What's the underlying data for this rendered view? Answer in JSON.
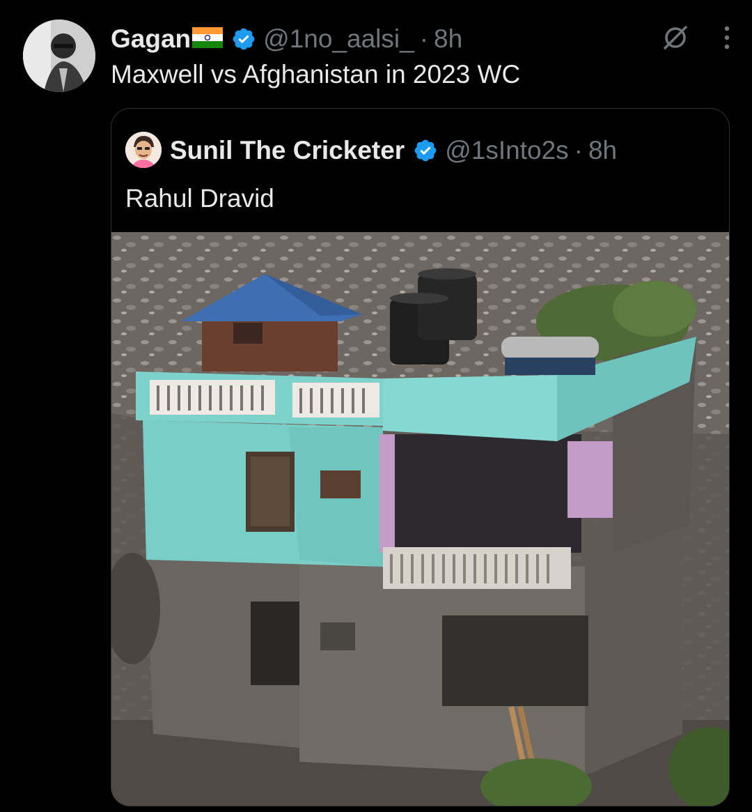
{
  "tweet": {
    "author_name": "Gagan",
    "flag_emoji_alt": "india-flag",
    "handle": "@1no_aalsi_",
    "separator": "·",
    "time": "8h",
    "text": "Maxwell vs Afghanistan in 2023 WC"
  },
  "quoted": {
    "author_name": "Sunil The Cricketer",
    "handle": "@1sInto2s",
    "separator": "·",
    "time": "8h",
    "text": "Rahul Dravid"
  },
  "colors": {
    "background": "#000000",
    "text": "#e7e9ea",
    "muted": "#71767b",
    "verified": "#1d9bf0",
    "border": "#2f3336"
  },
  "icons": [
    "verified-badge-icon",
    "grok-icon",
    "more-icon"
  ]
}
